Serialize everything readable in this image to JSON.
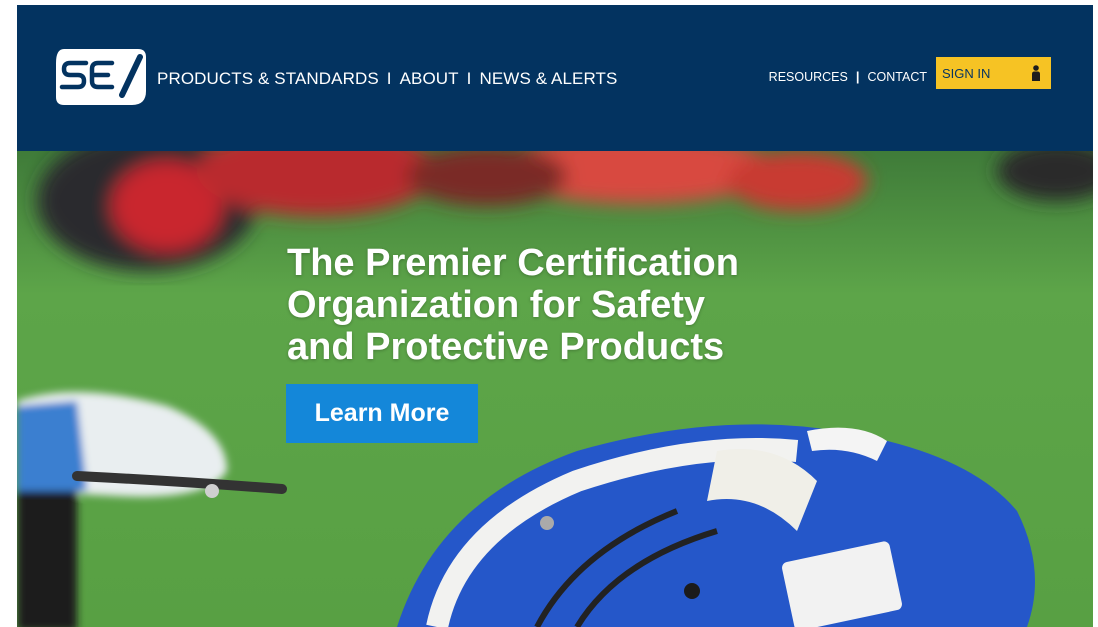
{
  "brand": {
    "logo_text": "SEI",
    "colors": {
      "header_bg": "#033360",
      "signin_bg": "#f6c324",
      "cta_bg": "#1487d9"
    }
  },
  "main_nav": {
    "items": [
      {
        "label": "PRODUCTS & STANDARDS"
      },
      {
        "label": "ABOUT"
      },
      {
        "label": "NEWS & ALERTS"
      }
    ],
    "separator": "I"
  },
  "util_nav": {
    "items": [
      {
        "label": "RESOURCES"
      },
      {
        "label": "CONTACT"
      }
    ],
    "separator": "|"
  },
  "signin": {
    "label": "SIGN IN",
    "icon": "user-icon"
  },
  "hero": {
    "headline_lines": [
      "The Premier Certification",
      "Organization for Safety",
      "and Protective Products"
    ],
    "cta_label": "Learn More"
  }
}
